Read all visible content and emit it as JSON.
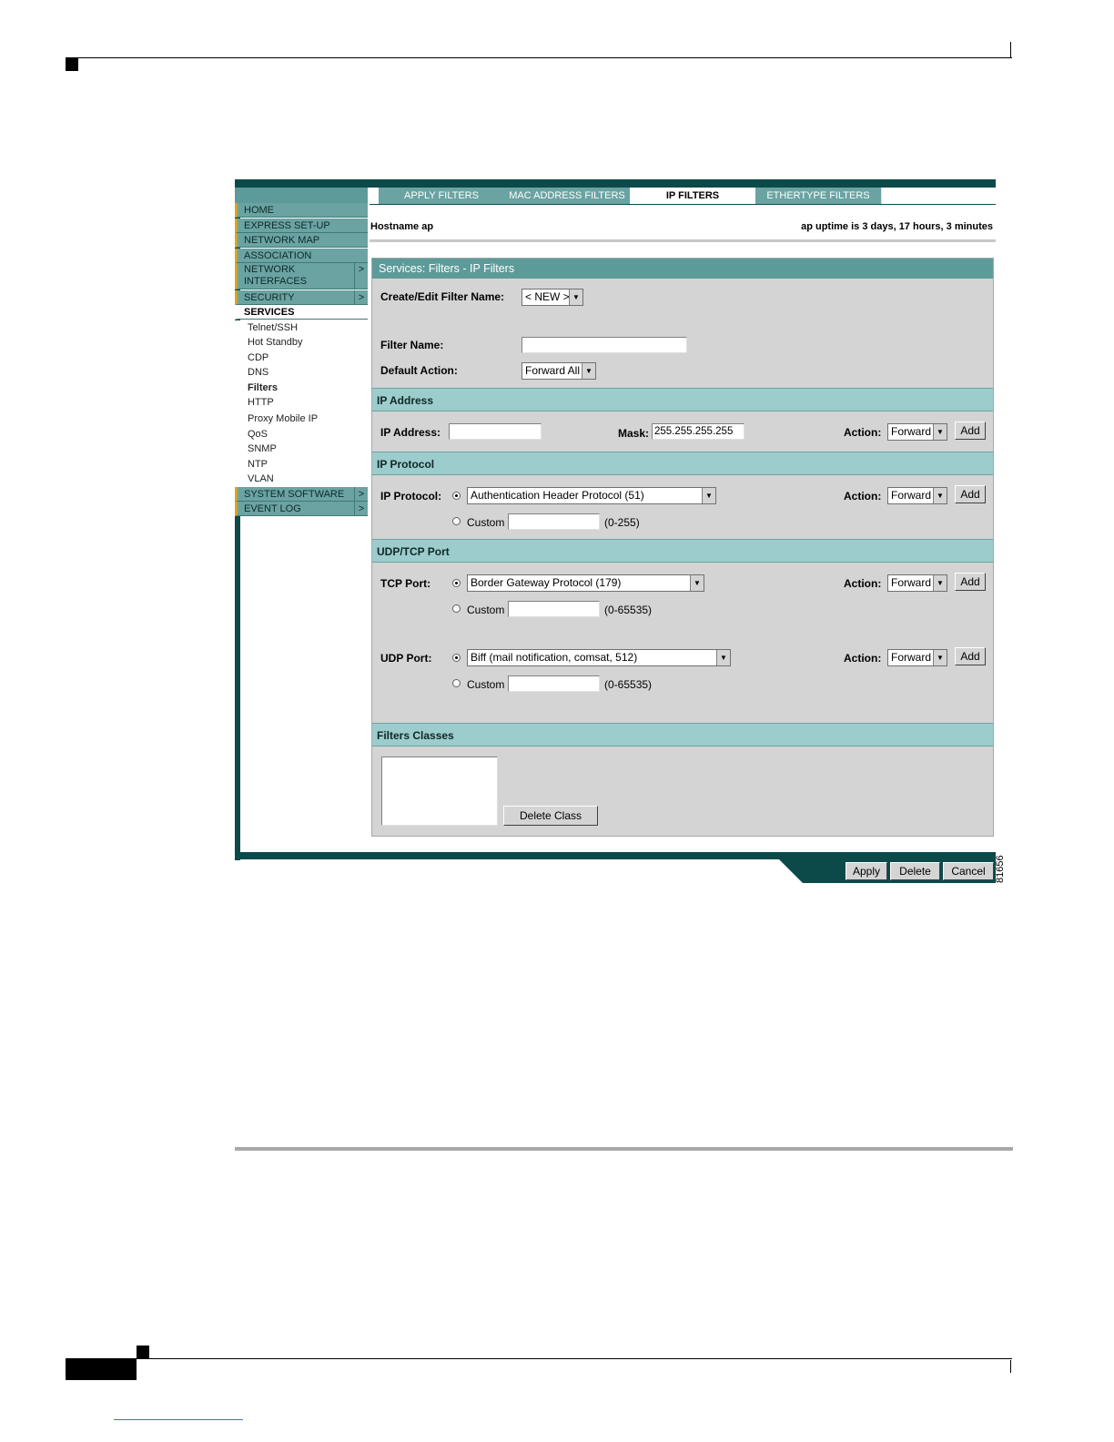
{
  "figure_number": "81656",
  "tabs": [
    {
      "label": "APPLY FILTERS"
    },
    {
      "label": "MAC ADDRESS FILTERS"
    },
    {
      "label": "IP FILTERS"
    },
    {
      "label": "ETHERTYPE FILTERS"
    }
  ],
  "nav": {
    "items": [
      {
        "label": "HOME"
      },
      {
        "label": "EXPRESS SET-UP"
      },
      {
        "label": "NETWORK MAP"
      },
      {
        "label": "ASSOCIATION"
      },
      {
        "label": "NETWORK INTERFACES",
        "arrow": ">"
      },
      {
        "label": "SECURITY",
        "arrow": ">"
      },
      {
        "label": "SERVICES"
      }
    ],
    "sub_items": [
      "Telnet/SSH",
      "Hot Standby",
      "CDP",
      "DNS",
      "Filters",
      "HTTP",
      "Proxy Mobile IP",
      "QoS",
      "SNMP",
      "NTP",
      "VLAN"
    ],
    "bottom_items": [
      {
        "label": "SYSTEM SOFTWARE",
        "arrow": ">"
      },
      {
        "label": "EVENT LOG",
        "arrow": ">"
      }
    ]
  },
  "header": {
    "hostname": "Hostname  ap",
    "uptime": "ap uptime is 3 days, 17 hours, 3 minutes"
  },
  "panel": {
    "title": "Services: Filters - IP Filters",
    "create_edit_label": "Create/Edit Filter Name:",
    "create_edit_value": "< NEW >",
    "filter_name_label": "Filter Name:",
    "filter_name_value": "",
    "default_action_label": "Default Action:",
    "default_action_value": "Forward All",
    "ip_address": {
      "heading": "IP Address",
      "address_label": "IP Address:",
      "address_value": "",
      "mask_label": "Mask:",
      "mask_value": "255.255.255.255",
      "action_label": "Action:",
      "action_value": "Forward",
      "add_label": "Add"
    },
    "ip_protocol": {
      "heading": "IP Protocol",
      "protocol_label": "IP Protocol:",
      "protocol_value": "Authentication Header Protocol (51)",
      "custom_label": "Custom",
      "custom_value": "",
      "range": "(0-255)",
      "action_label": "Action:",
      "action_value": "Forward",
      "add_label": "Add"
    },
    "udp_tcp": {
      "heading": "UDP/TCP Port",
      "tcp_label": "TCP Port:",
      "tcp_value": "Border Gateway Protocol (179)",
      "tcp_custom_label": "Custom",
      "tcp_custom_value": "",
      "tcp_range": "(0-65535)",
      "tcp_action_label": "Action:",
      "tcp_action_value": "Forward",
      "tcp_add_label": "Add",
      "udp_label": "UDP Port:",
      "udp_value": "Biff (mail notification, comsat, 512)",
      "udp_custom_label": "Custom",
      "udp_custom_value": "",
      "udp_range": "(0-65535)",
      "udp_action_label": "Action:",
      "udp_action_value": "Forward",
      "udp_add_label": "Add"
    },
    "filter_classes": {
      "heading": "Filters Classes",
      "delete_label": "Delete Class"
    }
  },
  "footer_buttons": {
    "apply": "Apply",
    "delete": "Delete",
    "cancel": "Cancel"
  }
}
